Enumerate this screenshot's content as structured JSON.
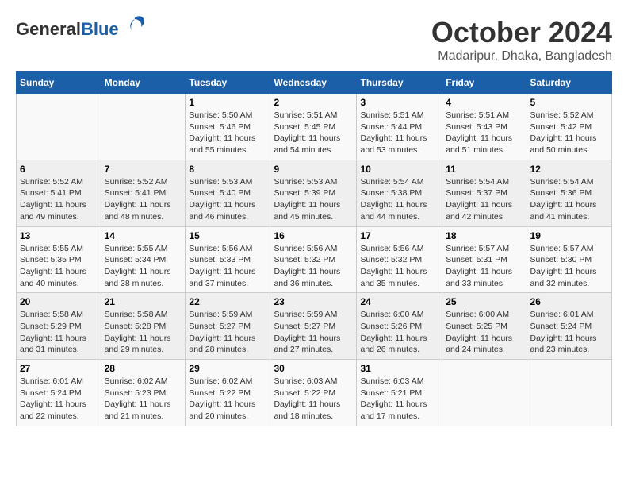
{
  "logo": {
    "general": "General",
    "blue": "Blue"
  },
  "title": "October 2024",
  "subtitle": "Madaripur, Dhaka, Bangladesh",
  "headers": [
    "Sunday",
    "Monday",
    "Tuesday",
    "Wednesday",
    "Thursday",
    "Friday",
    "Saturday"
  ],
  "weeks": [
    [
      {
        "day": "",
        "sunrise": "",
        "sunset": "",
        "daylight": ""
      },
      {
        "day": "",
        "sunrise": "",
        "sunset": "",
        "daylight": ""
      },
      {
        "day": "1",
        "sunrise": "Sunrise: 5:50 AM",
        "sunset": "Sunset: 5:46 PM",
        "daylight": "Daylight: 11 hours and 55 minutes."
      },
      {
        "day": "2",
        "sunrise": "Sunrise: 5:51 AM",
        "sunset": "Sunset: 5:45 PM",
        "daylight": "Daylight: 11 hours and 54 minutes."
      },
      {
        "day": "3",
        "sunrise": "Sunrise: 5:51 AM",
        "sunset": "Sunset: 5:44 PM",
        "daylight": "Daylight: 11 hours and 53 minutes."
      },
      {
        "day": "4",
        "sunrise": "Sunrise: 5:51 AM",
        "sunset": "Sunset: 5:43 PM",
        "daylight": "Daylight: 11 hours and 51 minutes."
      },
      {
        "day": "5",
        "sunrise": "Sunrise: 5:52 AM",
        "sunset": "Sunset: 5:42 PM",
        "daylight": "Daylight: 11 hours and 50 minutes."
      }
    ],
    [
      {
        "day": "6",
        "sunrise": "Sunrise: 5:52 AM",
        "sunset": "Sunset: 5:41 PM",
        "daylight": "Daylight: 11 hours and 49 minutes."
      },
      {
        "day": "7",
        "sunrise": "Sunrise: 5:52 AM",
        "sunset": "Sunset: 5:41 PM",
        "daylight": "Daylight: 11 hours and 48 minutes."
      },
      {
        "day": "8",
        "sunrise": "Sunrise: 5:53 AM",
        "sunset": "Sunset: 5:40 PM",
        "daylight": "Daylight: 11 hours and 46 minutes."
      },
      {
        "day": "9",
        "sunrise": "Sunrise: 5:53 AM",
        "sunset": "Sunset: 5:39 PM",
        "daylight": "Daylight: 11 hours and 45 minutes."
      },
      {
        "day": "10",
        "sunrise": "Sunrise: 5:54 AM",
        "sunset": "Sunset: 5:38 PM",
        "daylight": "Daylight: 11 hours and 44 minutes."
      },
      {
        "day": "11",
        "sunrise": "Sunrise: 5:54 AM",
        "sunset": "Sunset: 5:37 PM",
        "daylight": "Daylight: 11 hours and 42 minutes."
      },
      {
        "day": "12",
        "sunrise": "Sunrise: 5:54 AM",
        "sunset": "Sunset: 5:36 PM",
        "daylight": "Daylight: 11 hours and 41 minutes."
      }
    ],
    [
      {
        "day": "13",
        "sunrise": "Sunrise: 5:55 AM",
        "sunset": "Sunset: 5:35 PM",
        "daylight": "Daylight: 11 hours and 40 minutes."
      },
      {
        "day": "14",
        "sunrise": "Sunrise: 5:55 AM",
        "sunset": "Sunset: 5:34 PM",
        "daylight": "Daylight: 11 hours and 38 minutes."
      },
      {
        "day": "15",
        "sunrise": "Sunrise: 5:56 AM",
        "sunset": "Sunset: 5:33 PM",
        "daylight": "Daylight: 11 hours and 37 minutes."
      },
      {
        "day": "16",
        "sunrise": "Sunrise: 5:56 AM",
        "sunset": "Sunset: 5:32 PM",
        "daylight": "Daylight: 11 hours and 36 minutes."
      },
      {
        "day": "17",
        "sunrise": "Sunrise: 5:56 AM",
        "sunset": "Sunset: 5:32 PM",
        "daylight": "Daylight: 11 hours and 35 minutes."
      },
      {
        "day": "18",
        "sunrise": "Sunrise: 5:57 AM",
        "sunset": "Sunset: 5:31 PM",
        "daylight": "Daylight: 11 hours and 33 minutes."
      },
      {
        "day": "19",
        "sunrise": "Sunrise: 5:57 AM",
        "sunset": "Sunset: 5:30 PM",
        "daylight": "Daylight: 11 hours and 32 minutes."
      }
    ],
    [
      {
        "day": "20",
        "sunrise": "Sunrise: 5:58 AM",
        "sunset": "Sunset: 5:29 PM",
        "daylight": "Daylight: 11 hours and 31 minutes."
      },
      {
        "day": "21",
        "sunrise": "Sunrise: 5:58 AM",
        "sunset": "Sunset: 5:28 PM",
        "daylight": "Daylight: 11 hours and 29 minutes."
      },
      {
        "day": "22",
        "sunrise": "Sunrise: 5:59 AM",
        "sunset": "Sunset: 5:27 PM",
        "daylight": "Daylight: 11 hours and 28 minutes."
      },
      {
        "day": "23",
        "sunrise": "Sunrise: 5:59 AM",
        "sunset": "Sunset: 5:27 PM",
        "daylight": "Daylight: 11 hours and 27 minutes."
      },
      {
        "day": "24",
        "sunrise": "Sunrise: 6:00 AM",
        "sunset": "Sunset: 5:26 PM",
        "daylight": "Daylight: 11 hours and 26 minutes."
      },
      {
        "day": "25",
        "sunrise": "Sunrise: 6:00 AM",
        "sunset": "Sunset: 5:25 PM",
        "daylight": "Daylight: 11 hours and 24 minutes."
      },
      {
        "day": "26",
        "sunrise": "Sunrise: 6:01 AM",
        "sunset": "Sunset: 5:24 PM",
        "daylight": "Daylight: 11 hours and 23 minutes."
      }
    ],
    [
      {
        "day": "27",
        "sunrise": "Sunrise: 6:01 AM",
        "sunset": "Sunset: 5:24 PM",
        "daylight": "Daylight: 11 hours and 22 minutes."
      },
      {
        "day": "28",
        "sunrise": "Sunrise: 6:02 AM",
        "sunset": "Sunset: 5:23 PM",
        "daylight": "Daylight: 11 hours and 21 minutes."
      },
      {
        "day": "29",
        "sunrise": "Sunrise: 6:02 AM",
        "sunset": "Sunset: 5:22 PM",
        "daylight": "Daylight: 11 hours and 20 minutes."
      },
      {
        "day": "30",
        "sunrise": "Sunrise: 6:03 AM",
        "sunset": "Sunset: 5:22 PM",
        "daylight": "Daylight: 11 hours and 18 minutes."
      },
      {
        "day": "31",
        "sunrise": "Sunrise: 6:03 AM",
        "sunset": "Sunset: 5:21 PM",
        "daylight": "Daylight: 11 hours and 17 minutes."
      },
      {
        "day": "",
        "sunrise": "",
        "sunset": "",
        "daylight": ""
      },
      {
        "day": "",
        "sunrise": "",
        "sunset": "",
        "daylight": ""
      }
    ]
  ]
}
